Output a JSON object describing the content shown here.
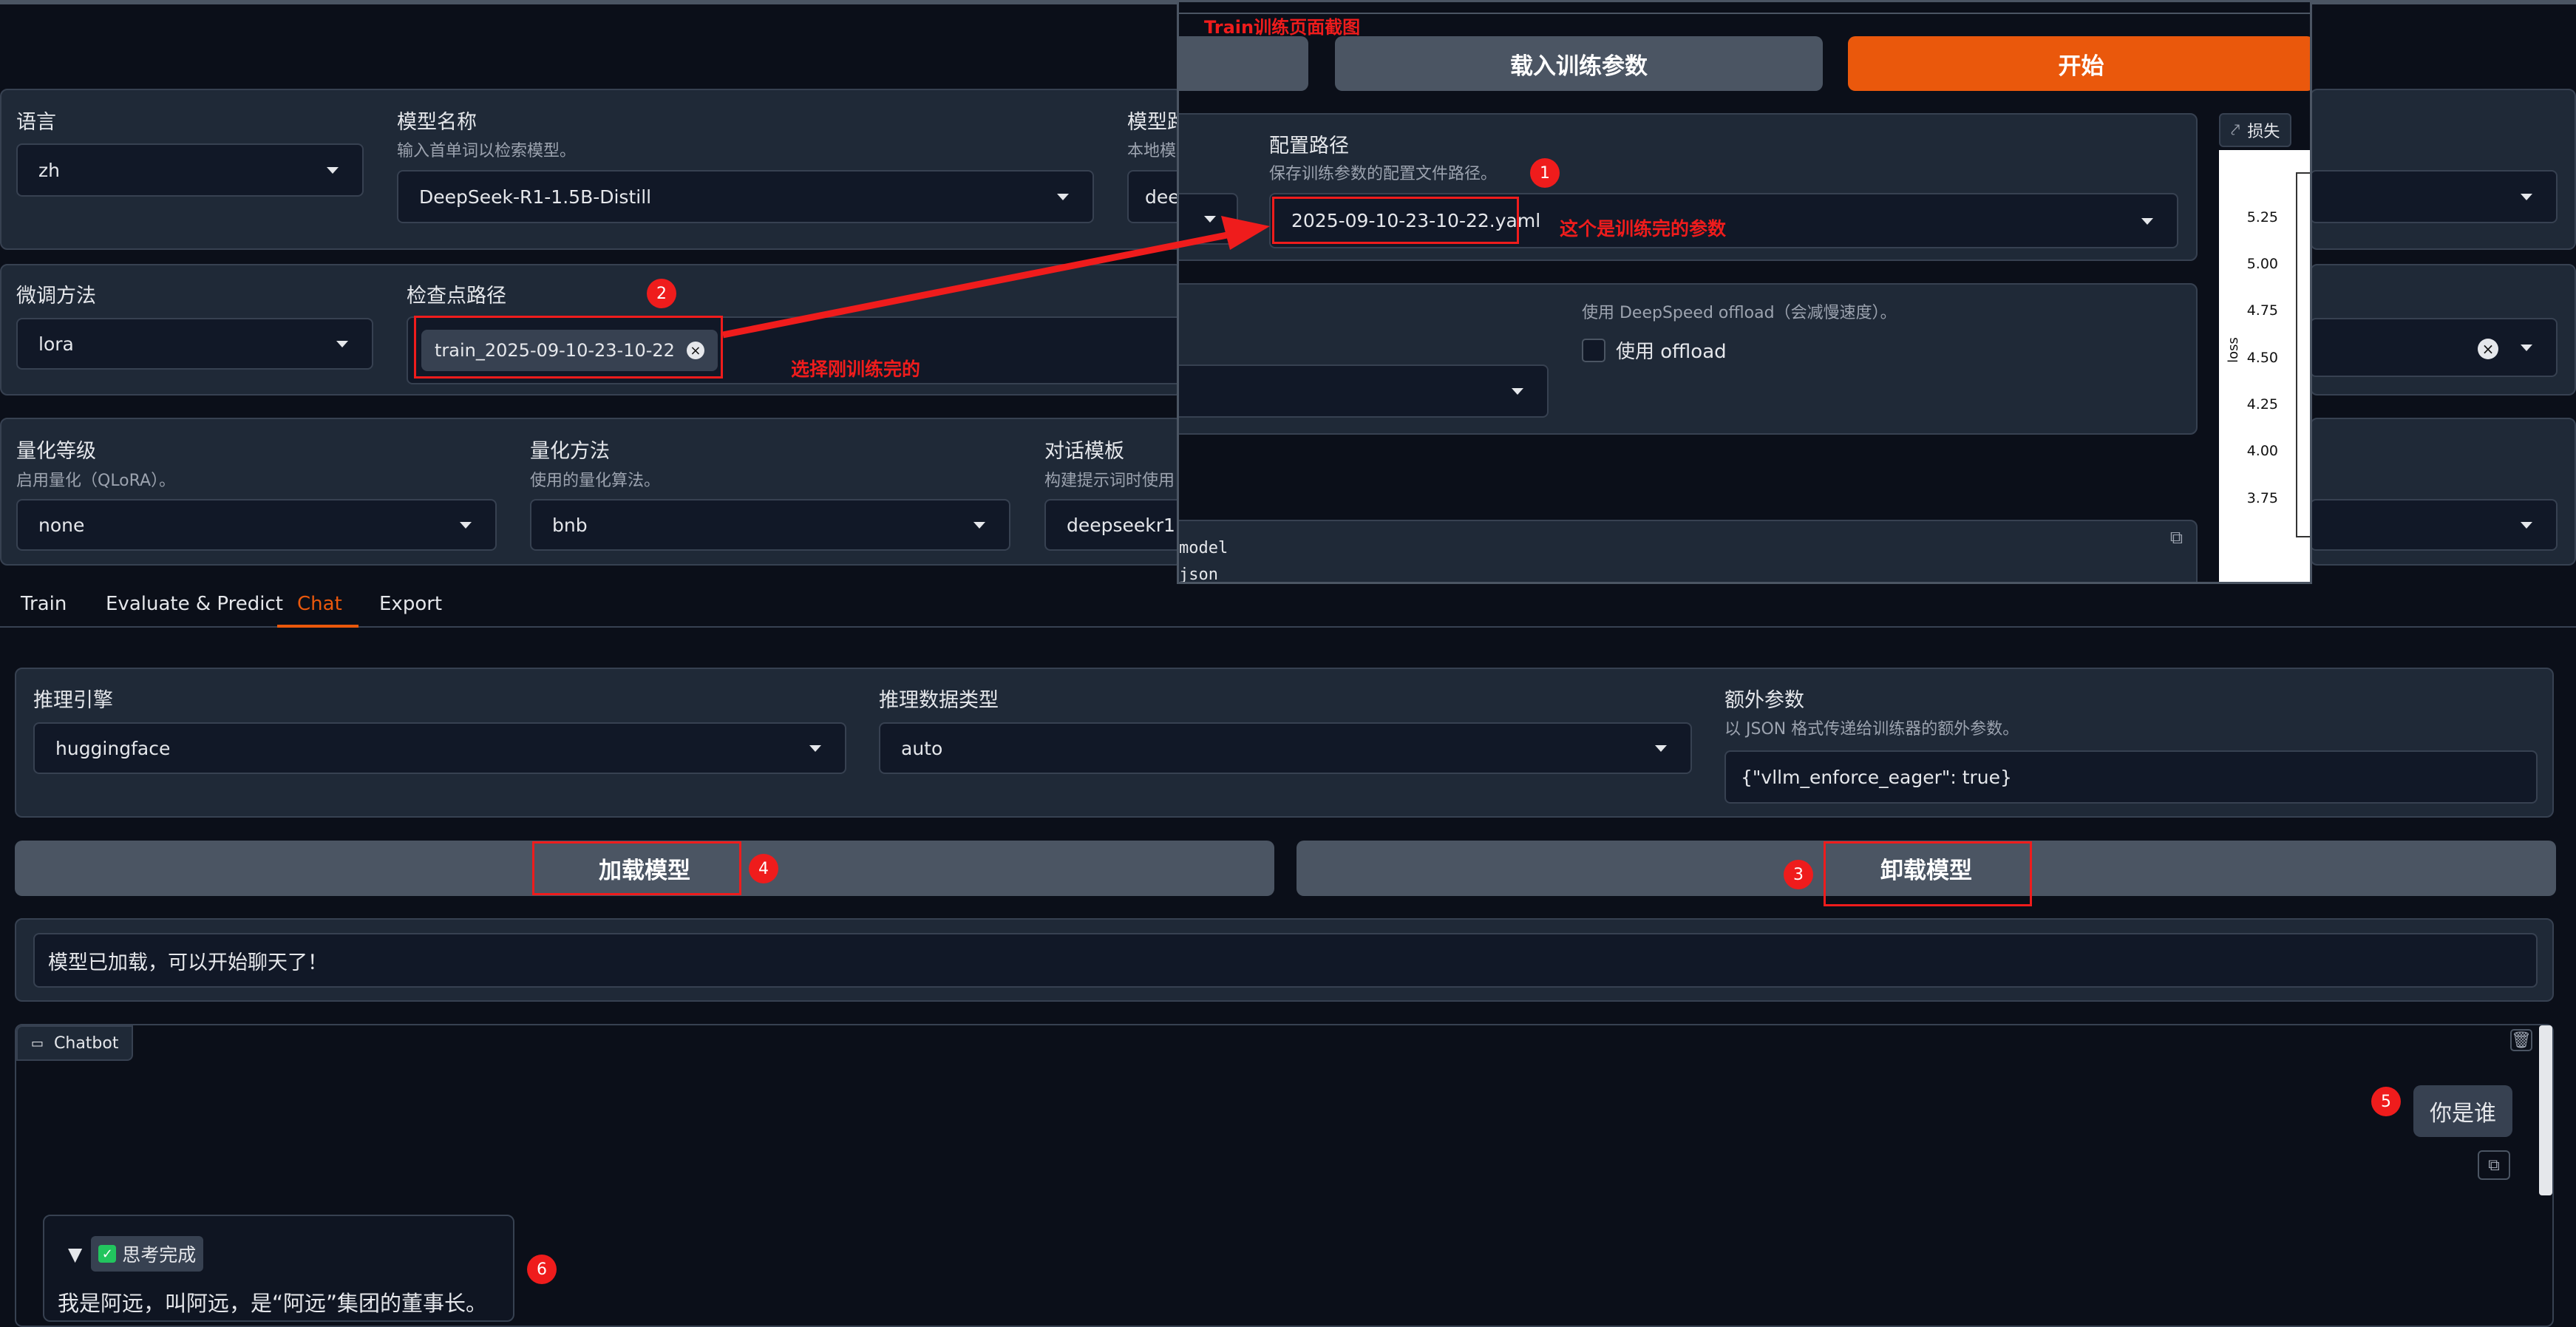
{
  "left": {
    "language": {
      "label": "语言",
      "value": "zh"
    },
    "model_name": {
      "label": "模型名称",
      "hint": "输入首单词以检索模型。",
      "value": "DeepSeek-R1-1.5B-Distill"
    },
    "model_path": {
      "label": "模型路",
      "hint": "本地模",
      "value": "deep"
    },
    "finetune": {
      "label": "微调方法",
      "value": "lora"
    },
    "checkpoint": {
      "label": "检查点路径",
      "value": "train_2025-09-10-23-10-22"
    },
    "quant_bit": {
      "label": "量化等级",
      "hint": "启用量化（QLoRA）。",
      "value": "none"
    },
    "quant_method": {
      "label": "量化方法",
      "hint": "使用的量化算法。",
      "value": "bnb"
    },
    "template": {
      "label": "对话模板",
      "hint": "构建提示词时使用",
      "value": "deepseekr1"
    }
  },
  "tabs": [
    "Train",
    "Evaluate & Predict",
    "Chat",
    "Export"
  ],
  "active_tab": "Chat",
  "chat": {
    "infer_backend": {
      "label": "推理引擎",
      "value": "huggingface"
    },
    "infer_dtype": {
      "label": "推理数据类型",
      "value": "auto"
    },
    "extra_args": {
      "label": "额外参数",
      "hint": "以 JSON 格式传递给训练器的额外参数。",
      "value": "{\"vllm_enforce_eager\": true}"
    },
    "load_btn": "加载模型",
    "unload_btn": "卸载模型",
    "info": "模型已加载，可以开始聊天了！",
    "chatbot_label": "Chatbot",
    "user_message": "你是谁",
    "thinking_label": "思考完成",
    "bot_message": "我是阿远，叫阿远，是“阿远”集团的董事长。"
  },
  "overlay": {
    "title": "Train训练页面截图",
    "load_params_btn": "载入训练参数",
    "start_btn": "开始",
    "config_path": {
      "label": "配置路径",
      "hint": "保存训练参数的配置文件路径。",
      "value": "2025-09-10-23-10-22.yaml"
    },
    "ds_offload": {
      "hint": "使用 DeepSpeed offload（会减慢速度）。",
      "checkbox": "使用 offload"
    },
    "code_lines": [
      "model",
      "json"
    ],
    "loss_tab": "损失",
    "ylabel": "loss",
    "yticks": [
      "5.25",
      "5.00",
      "4.75",
      "4.50",
      "4.25",
      "4.00",
      "3.75"
    ]
  },
  "annotations": {
    "n1": "1",
    "n2": "2",
    "n3": "3",
    "n4": "4",
    "n5": "5",
    "n6": "6",
    "select_ckpt": "选择刚训练完的",
    "trained_params": "这个是训练完的参数"
  },
  "colors": {
    "accent": "#ea580c",
    "annotation": "#ef1c1c",
    "bg": "#0b0f19",
    "panel": "#1f2937"
  }
}
